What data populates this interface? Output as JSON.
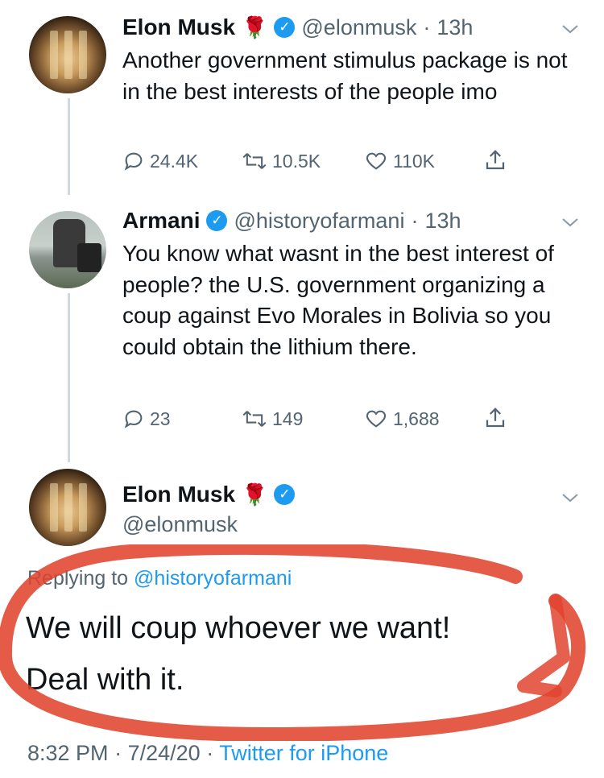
{
  "tweet1": {
    "name": "Elon Musk",
    "handle": "@elonmusk",
    "time": "13h",
    "text": "Another government stimulus package is not in the best interests of the people imo",
    "replies": "24.4K",
    "retweets": "10.5K",
    "likes": "110K"
  },
  "tweet2": {
    "name": "Armani",
    "handle": "@historyofarmani",
    "time": "13h",
    "text": "You know what wasnt in the best interest of people? the U.S. government organizing a coup against Evo Morales in Bolivia so you could obtain the lithium there.",
    "replies": "23",
    "retweets": "149",
    "likes": "1,688"
  },
  "tweet3": {
    "name": "Elon Musk",
    "handle": "@elonmusk",
    "replying_prefix": "Replying to",
    "replying_to": "@historyofarmani",
    "line1": "We will coup whoever we want!",
    "line2": "Deal with it.",
    "time": "8:32 PM",
    "date": "7/24/20",
    "source": "Twitter for iPhone"
  },
  "icons": {
    "rose": "rose-emoji",
    "verified": "verified-badge",
    "reply": "reply-icon",
    "retweet": "retweet-icon",
    "like": "heart-icon",
    "share": "share-icon",
    "more": "chevron-down-icon"
  },
  "colors": {
    "accent": "#1d9bf0",
    "annotation": "#e0442f",
    "muted": "#536471"
  }
}
